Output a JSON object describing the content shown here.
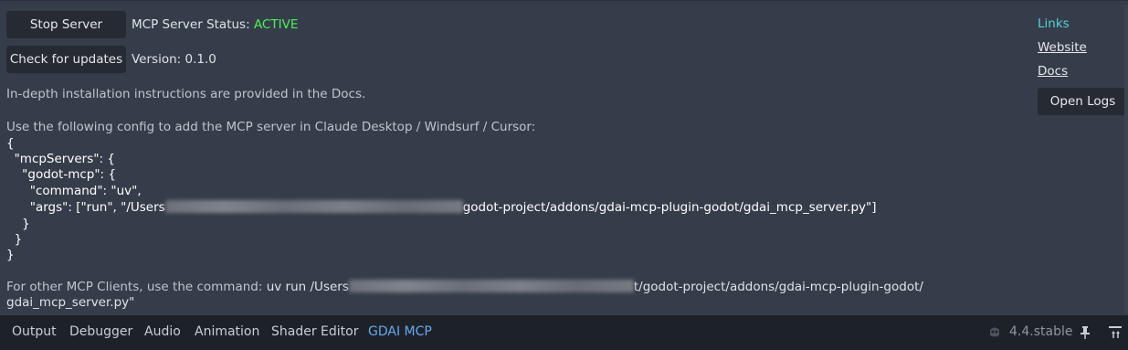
{
  "buttons": {
    "stop_server": "Stop Server",
    "check_updates": "Check for updates",
    "open_logs": "Open Logs"
  },
  "status": {
    "label": "MCP Server Status:",
    "value": "ACTIVE",
    "color": "#4df05a"
  },
  "version": "Version: 0.1.0",
  "install_note": "In-depth installation instructions are provided in the Docs.",
  "config_intro": "Use the following config to add the MCP server in Claude Desktop / Windsurf / Cursor:",
  "config": {
    "line1": "{",
    "line2": "  \"mcpServers\": {",
    "line3": "    \"godot-mcp\": {",
    "line4": "      \"command\": \"uv\",",
    "line5_prefix": "      \"args\": [\"run\", \"/Users",
    "line5_suffix": "godot-project/addons/gdai-mcp-plugin-godot/gdai_mcp_server.py\"]",
    "line6": "    }",
    "line7": "  }",
    "line8": "}"
  },
  "other_clients": {
    "label": "For other MCP Clients, use the command:",
    "cmd_prefix": "uv run /Users",
    "cmd_suffix": "t/godot-project/addons/gdai-mcp-plugin-godot/",
    "cmd_line2": "gdai_mcp_server.py\""
  },
  "links": {
    "heading": "Links",
    "website": "Website",
    "docs": "Docs",
    "heading_color": "#56d0d3"
  },
  "bottom_tabs": [
    "Output",
    "Debugger",
    "Audio",
    "Animation",
    "Shader Editor",
    "GDAI MCP"
  ],
  "active_tab": "GDAI MCP",
  "engine_version": "4.4.stable",
  "icons": {
    "engine": "godot-logo-icon",
    "pin": "pin-icon",
    "expand": "expand-panel-icon"
  }
}
